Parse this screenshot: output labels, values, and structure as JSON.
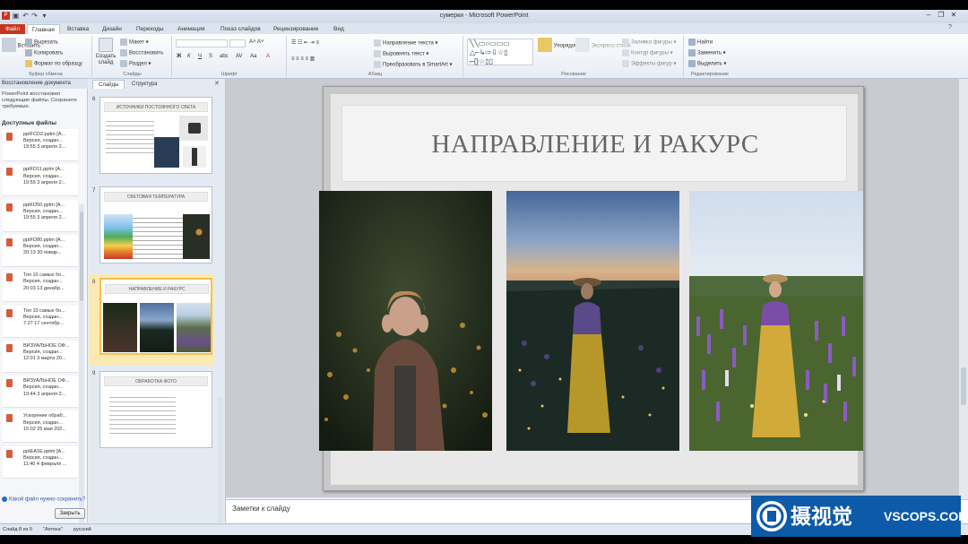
{
  "window": {
    "title": "сумерки - Microsoft PowerPoint"
  },
  "ribbon": {
    "tabs": [
      "Файл",
      "Главная",
      "Вставка",
      "Дизайн",
      "Переходы",
      "Анимация",
      "Показ слайдов",
      "Рецензирование",
      "Вид"
    ],
    "clipboard": {
      "paste": "Вставить",
      "cut": "Вырезать",
      "copy": "Копировать",
      "format": "Формат по образцу",
      "label": "Буфер обмена"
    },
    "slides": {
      "create": "Создать слайд",
      "layout": "Макет",
      "reset": "Восстановить",
      "section": "Раздел",
      "label": "Слайды"
    },
    "font": {
      "label": "Шрифт"
    },
    "paragraph": {
      "text_dir": "Направление текста",
      "align_text": "Выровнять текст",
      "smartart": "Преобразовать в SmartArt",
      "label": "Абзац"
    },
    "drawing": {
      "arrange": "Упорядочить",
      "styles": "Экспресс-стили",
      "fill": "Заливка фигуры",
      "outline": "Контур фигуры",
      "effects": "Эффекты фигур",
      "label": "Рисование"
    },
    "editing": {
      "find": "Найти",
      "replace": "Заменить",
      "select": "Выделить",
      "label": "Редактирование"
    }
  },
  "recovery": {
    "title": "Восстановление документа",
    "desc": "PowerPoint восстановил следующие файлы. Сохраните требуемые.",
    "available": "Доступные файлы",
    "files": [
      {
        "name": "pptFCD2.pptm [А...",
        "line2": "Версия, создан...",
        "line3": "19:55 3 апреля 2..."
      },
      {
        "name": "pptFD11.pptm [А...",
        "line2": "Версия, создан...",
        "line3": "19:55 3 апреля 2..."
      },
      {
        "name": "pptFD50.pptm [А...",
        "line2": "Версия, создан...",
        "line3": "19:55 3 апреля 2..."
      },
      {
        "name": "pptFD80.pptm [А...",
        "line2": "Версия, создан...",
        "line3": "20:13 30 январ..."
      },
      {
        "name": "Топ 10 самых бо...",
        "line2": "Версия, создан...",
        "line3": "20:03 13 декабр..."
      },
      {
        "name": "Топ 10 самых бо...",
        "line2": "Версия, создан...",
        "line3": "7:27 17 сентябр..."
      },
      {
        "name": "ВИЗУАЛЬНОЕ ОФ...",
        "line2": "Версия, создан...",
        "line3": "12:01 3 марта 20..."
      },
      {
        "name": "ВИЗУАЛЬНОЕ ОФ...",
        "line2": "Версия, создан...",
        "line3": "19:44 3 апреля 2..."
      },
      {
        "name": "Ускорение обраб...",
        "line2": "Версия, создан...",
        "line3": "15:02 25 мая 202..."
      },
      {
        "name": "pptEA1E.pptm [А...",
        "line2": "Версия, создан...",
        "line3": "11:40 4 февраля ..."
      }
    ],
    "help_link": "Какой файл нужно сохранить?",
    "close_btn": "Закрыть"
  },
  "thumbs": {
    "tab_slides": "Слайды",
    "tab_outline": "Структура",
    "items": [
      {
        "num": "6",
        "title": "ИСТОЧНИКИ ПОСТОЯННОГО СВЕТА"
      },
      {
        "num": "7",
        "title": "СВЕТОВАЯ ТЕМПЕРАТУРА"
      },
      {
        "num": "8",
        "title": "НАПРАВЛЕНИЕ И РАКУРС"
      },
      {
        "num": "9",
        "title": "ОБРАБОТКА ФОТО"
      }
    ]
  },
  "slide": {
    "title": "НАПРАВЛЕНИЕ И РАКУРС"
  },
  "notes": {
    "placeholder": "Заметки к слайду"
  },
  "status": {
    "slide": "Слайд 8 из 9",
    "theme": "\"Аптека\"",
    "lang": "русский"
  },
  "watermark": {
    "cn": "摄视觉",
    "en": "VSCOPS.COM"
  },
  "colors": {
    "file_tab": "#c4371f",
    "selected_thumb": "#f2c14a",
    "watermark_bg": "#0d5aa8"
  }
}
